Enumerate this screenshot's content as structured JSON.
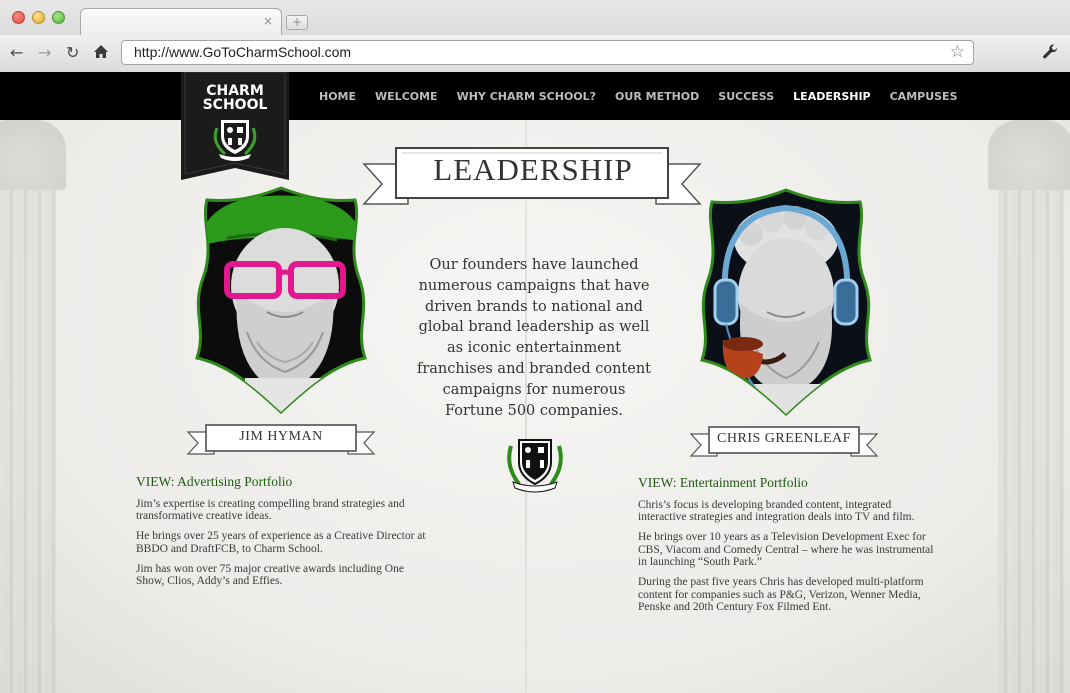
{
  "browser": {
    "url": "http://www.GoToCharmSchool.com",
    "tab_close": "×",
    "new_tab": "+",
    "back_icon": "arrow-left",
    "forward_icon": "arrow-right",
    "reload_icon": "reload",
    "home_icon": "home",
    "bookmark_icon": "star",
    "settings_icon": "wrench"
  },
  "logo": {
    "line1": "CHARM",
    "line2": "SCHOOL"
  },
  "nav": {
    "items": [
      {
        "label": "HOME"
      },
      {
        "label": "WELCOME"
      },
      {
        "label": "WHY CHARM SCHOOL?"
      },
      {
        "label": "OUR METHOD"
      },
      {
        "label": "SUCCESS"
      },
      {
        "label": "LEADERSHIP",
        "active": true
      },
      {
        "label": "CAMPUSES"
      }
    ]
  },
  "page": {
    "title": "LEADERSHIP",
    "intro": "Our founders have launched numerous campaigns that have driven brands to national and global brand leadership as well as iconic entertainment franchises and branded content campaigns for numerous Fortune 500 companies."
  },
  "leaders": [
    {
      "name": "JIM HYMAN",
      "link": "VIEW: Advertising Portfolio",
      "paragraphs": [
        "Jim’s expertise is creating compelling brand strategies and transformative creative ideas.",
        "He brings over 25 years of experience as a Creative Director at BBDO and DraftFCB, to Charm School.",
        "Jim  has won over 75 major creative awards including One Show, Clios, Addy’s and Effies."
      ]
    },
    {
      "name": "CHRIS GREENLEAF",
      "link": "VIEW: Entertainment Portfolio",
      "paragraphs": [
        "Chris’s focus is developing branded content, integrated interactive strategies and integration deals into TV and film.",
        "He brings over 10 years as a Television Development Exec for CBS, Viacom and Comedy Central – where he was instrumental in launching “South Park.”",
        "During the past five years Chris has developed multi-platform content for companies such as P&G, Verizon, Wenner Media, Penske and 20th Century Fox Filmed Ent."
      ]
    }
  ],
  "colors": {
    "accent_green": "#2f8a1c",
    "link_green": "#1e5a10",
    "nav_bg": "#000000",
    "glasses_pink": "#e0198f"
  }
}
